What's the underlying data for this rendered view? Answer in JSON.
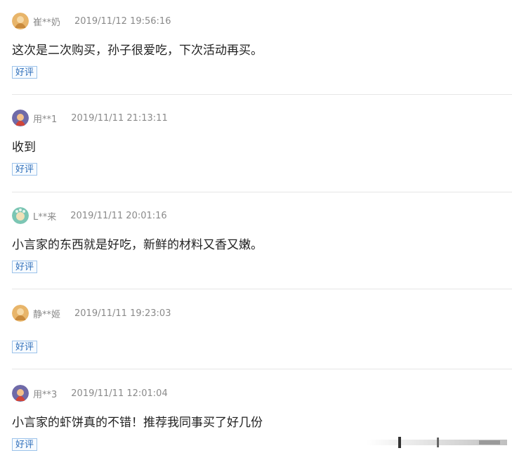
{
  "reviews": [
    {
      "user": "崔**奶",
      "time": "2019/11/12 19:56:16",
      "text": "这次是二次购买，孙子很爱吃，下次活动再买。",
      "tag": "好评",
      "avatar": "orange-avatar-icon"
    },
    {
      "user": "用**1",
      "time": "2019/11/11 21:13:11",
      "text": "收到",
      "tag": "好评",
      "avatar": "purple-avatar-icon"
    },
    {
      "user": "L**来",
      "time": "2019/11/11 20:01:16",
      "text": "小言家的东西就是好吃，新鲜的材料又香又嫩。",
      "tag": "好评",
      "avatar": "teal-avatar-icon"
    },
    {
      "user": "静**姬",
      "time": "2019/11/11 19:23:03",
      "text": "",
      "tag": "好评",
      "avatar": "orange-avatar-icon"
    },
    {
      "user": "用**3",
      "time": "2019/11/11 12:01:04",
      "text": "小言家的虾饼真的不错！推荐我同事买了好几份",
      "tag": "好评",
      "avatar": "purple-avatar-icon"
    }
  ],
  "colors": {
    "tag_border": "#9cc2ea",
    "tag_text": "#2f6fba",
    "meta_text": "#8a8a8a",
    "divider": "#e6e6e6"
  }
}
